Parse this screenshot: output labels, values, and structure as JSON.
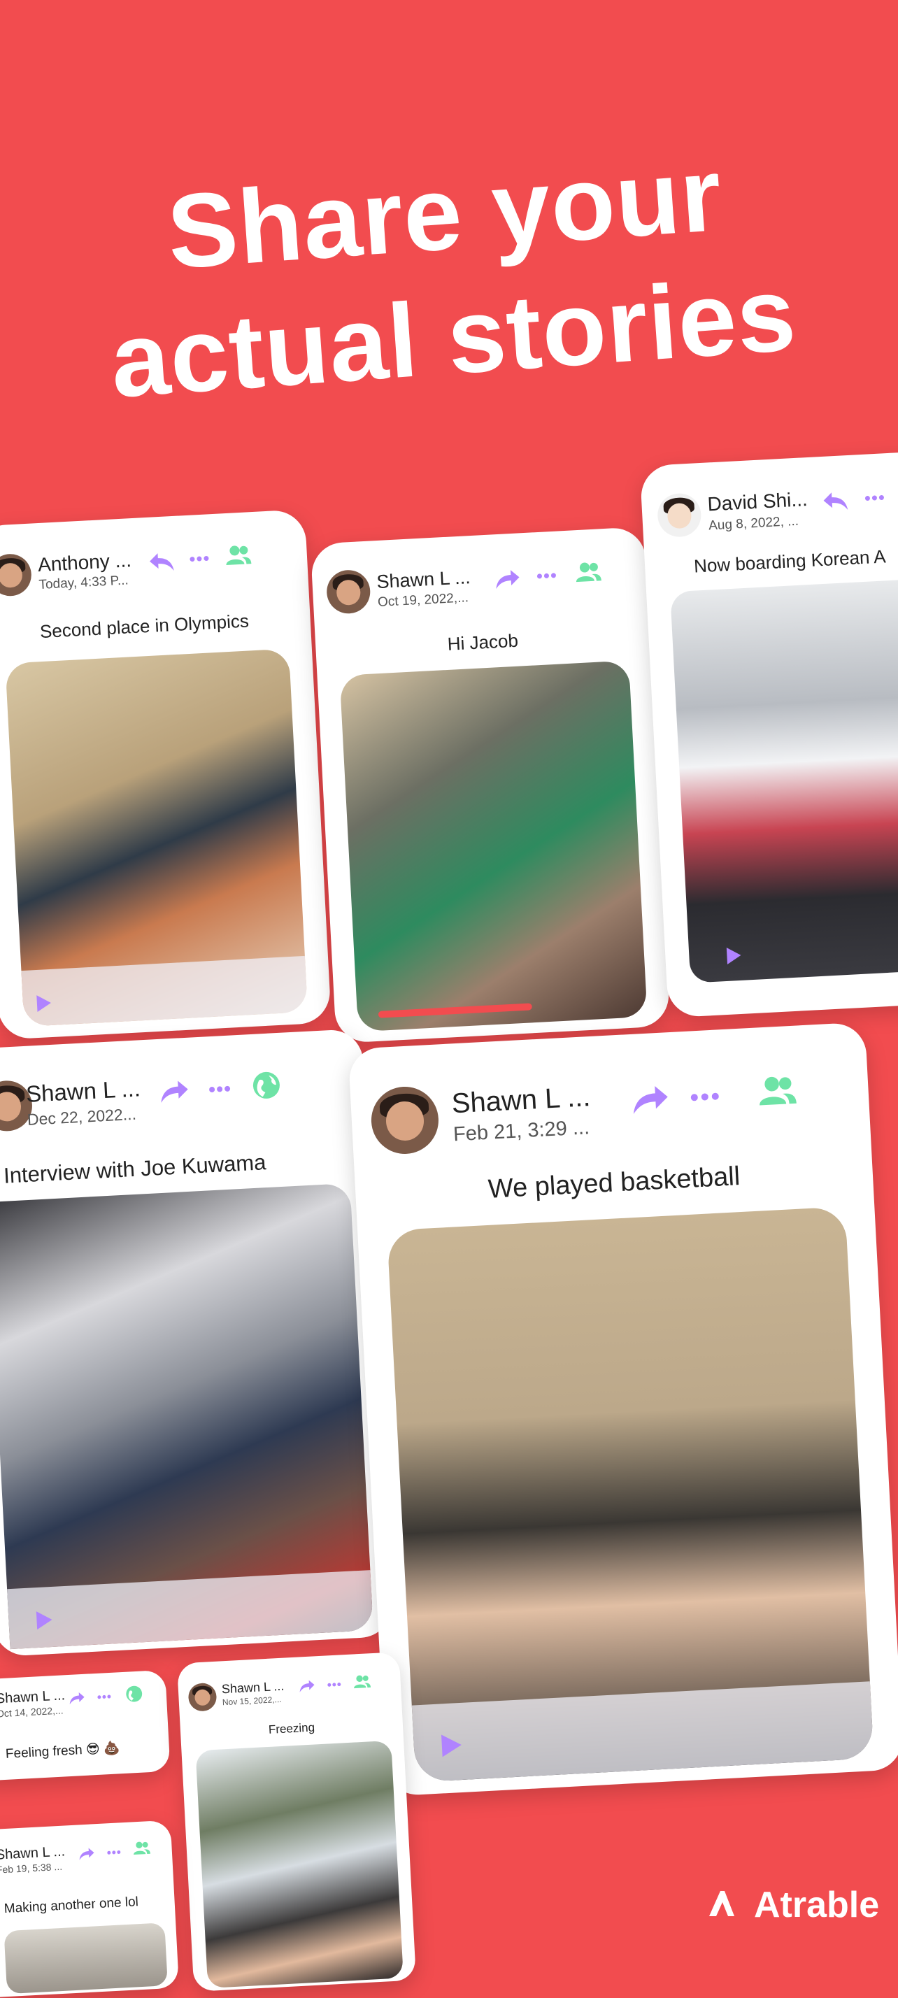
{
  "headline": {
    "line1": "Share your",
    "line2": "actual stories"
  },
  "brand": {
    "name": "Atrable"
  },
  "colors": {
    "background": "#f24c4f",
    "accent_purple": "#b083ff",
    "accent_green": "#6ee3a6"
  },
  "posts": [
    {
      "name": "Anthony ...",
      "date": "Today, 4:33 P...",
      "caption": "Second place in Olympics",
      "action_icon": "reply-icon",
      "audience_icon": "friends-icon"
    },
    {
      "name": "Shawn L ...",
      "date": "Oct 19, 2022,...",
      "caption": "Hi Jacob",
      "action_icon": "share-icon",
      "audience_icon": "friends-icon"
    },
    {
      "name": "David Shi...",
      "date": "Aug 8, 2022, ...",
      "caption": "Now boarding Korean A",
      "action_icon": "reply-icon",
      "audience_icon": "friends-icon"
    },
    {
      "name": "Shawn L ...",
      "date": "Dec 22, 2022...",
      "caption": "Interview with Joe Kuwama",
      "action_icon": "share-icon",
      "audience_icon": "globe-icon"
    },
    {
      "name": "Shawn L ...",
      "date": "Feb 21, 3:29 ...",
      "caption": "We played basketball",
      "action_icon": "share-icon",
      "audience_icon": "friends-icon"
    },
    {
      "name": "Shawn L ...",
      "date": "Oct 14, 2022,...",
      "caption": "Feeling fresh 😎 💩",
      "action_icon": "share-icon",
      "audience_icon": "globe-icon"
    },
    {
      "name": "Shawn L ...",
      "date": "Nov 15, 2022,...",
      "caption": "Freezing",
      "action_icon": "share-icon",
      "audience_icon": "friends-icon"
    },
    {
      "name": "Shawn L ...",
      "date": "Feb 19, 5:38 ...",
      "caption": "Making another one lol",
      "action_icon": "share-icon",
      "audience_icon": "friends-icon"
    }
  ]
}
